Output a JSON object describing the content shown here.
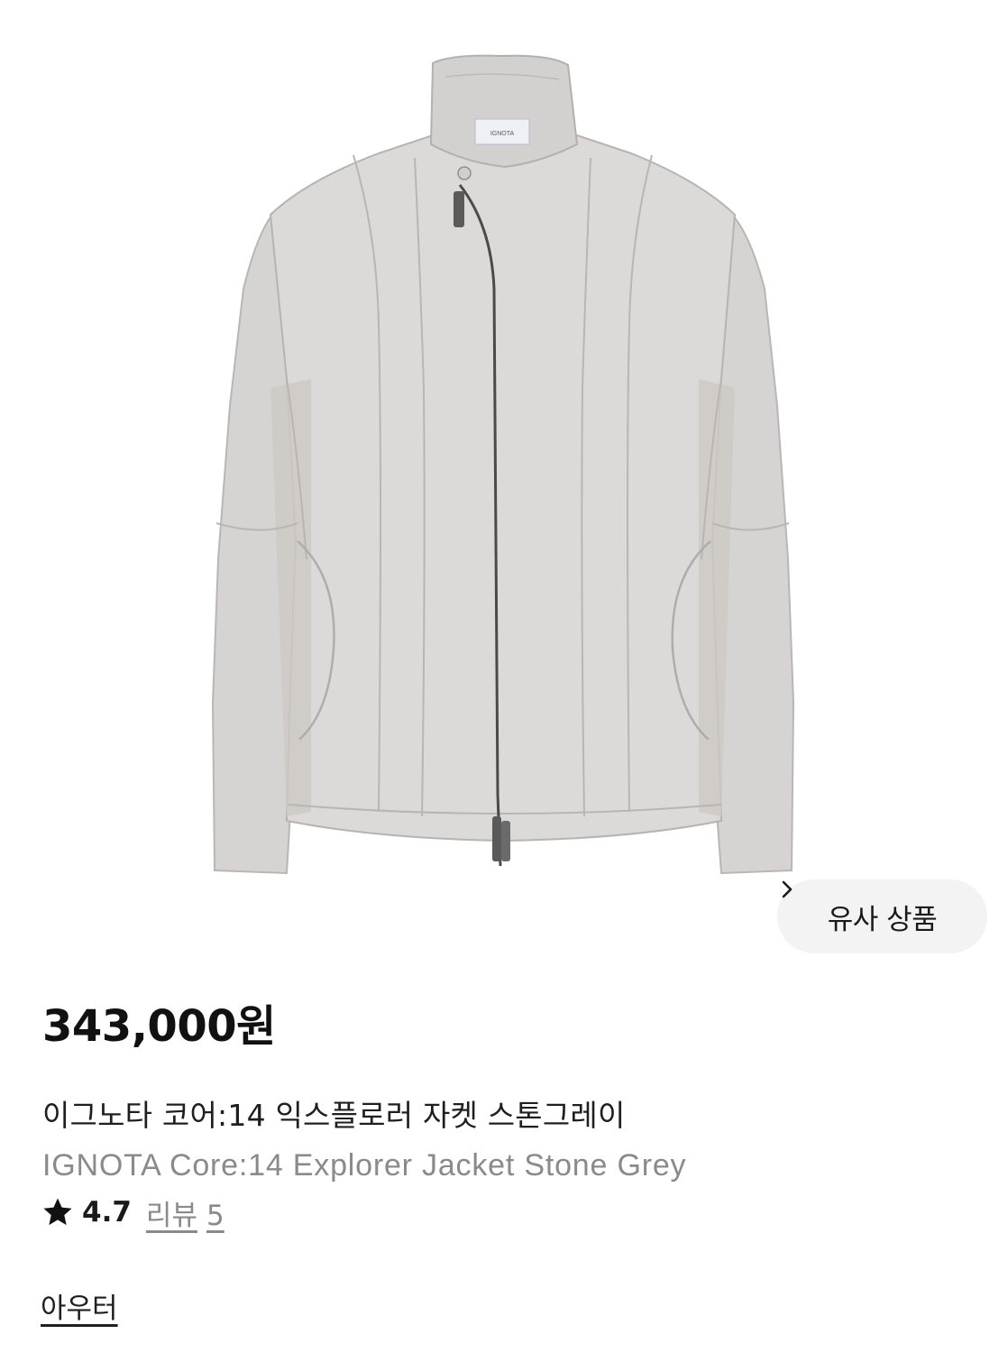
{
  "product": {
    "brand_label": "IGNOTA",
    "price": "343,000원",
    "name_korean": "이그노타 코어:14 익스플로러 자켓 스톤그레이",
    "name_english": "IGNOTA Core:14 Explorer Jacket Stone Grey",
    "rating": "4.7",
    "review_label": "리뷰",
    "review_count": "5",
    "category": "아우터"
  },
  "similar_button": {
    "label": "유사 상품"
  },
  "colors": {
    "jacket": "#d9d7d6",
    "jacket_shadow": "#c9c6c3",
    "background": "#ffffff",
    "button_bg": "#f3f3f3",
    "secondary_text": "#8a8a8a"
  },
  "icons": {
    "similar_chevron": "chevron-right-icon",
    "rating_star": "star-icon"
  }
}
